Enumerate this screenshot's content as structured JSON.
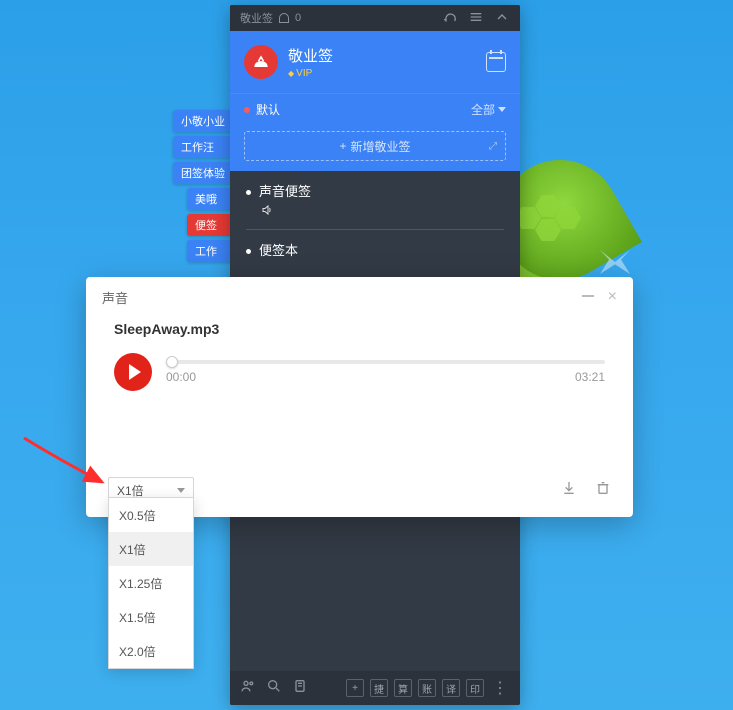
{
  "app": {
    "titlebar": {
      "name": "敬业签",
      "bell_count": "0"
    },
    "header": {
      "name": "敬业签",
      "vip": "VIP"
    },
    "subbar": {
      "category": "默认",
      "filter": "全部"
    },
    "add_placeholder": "新增敬业签",
    "items": [
      {
        "title": "声音便签",
        "has_sound": true
      },
      {
        "title": "便签本",
        "has_sound": false
      }
    ],
    "bottom_labels": [
      "捷",
      "算",
      "账",
      "译",
      "印"
    ]
  },
  "sidetabs": [
    "小敬小业",
    "工作汪",
    "团签体验",
    "美哦",
    "便签",
    "工作"
  ],
  "dialog": {
    "title": "声音",
    "filename": "SleepAway.mp3",
    "current_time": "00:00",
    "duration": "03:21"
  },
  "speed": {
    "selected": "X1倍",
    "options": [
      "X0.5倍",
      "X1倍",
      "X1.25倍",
      "X1.5倍",
      "X2.0倍"
    ]
  }
}
